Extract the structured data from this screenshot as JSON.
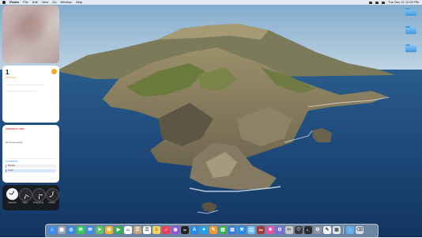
{
  "menubar": {
    "app_name": "Finder",
    "menus": [
      "File",
      "Edit",
      "View",
      "Go",
      "Window",
      "Help"
    ],
    "clock": "Tue Dec 21 12:00 PM"
  },
  "widgets": {
    "reminders": {
      "count": "1",
      "title": "Reminders"
    },
    "calendar": {
      "month": "THURSDAY 2021",
      "note": "No more events",
      "subheading": "TOMORROW",
      "events": [
        "Meeting",
        "Lunch"
      ]
    },
    "clocks": [
      {
        "city": "Cupertino",
        "style": "light"
      },
      {
        "city": "Tokyo",
        "style": "dark"
      },
      {
        "city": "Hong Kong",
        "style": "dark"
      },
      {
        "city": "London",
        "style": "dark"
      }
    ]
  },
  "dock": {
    "apps": [
      {
        "name": "Finder",
        "icon": "finder-icon",
        "color": "#3b8ff0",
        "glyph": "☺"
      },
      {
        "name": "Launchpad",
        "icon": "launchpad-icon",
        "color": "#9aa4b4",
        "glyph": "▦"
      },
      {
        "name": "Safari",
        "icon": "safari-icon",
        "color": "#2e8ae6",
        "glyph": "◎"
      },
      {
        "name": "Messages",
        "icon": "messages-icon",
        "color": "#34c759",
        "glyph": "✉"
      },
      {
        "name": "Mail",
        "icon": "mail-icon",
        "color": "#3a8ee6",
        "glyph": "✉"
      },
      {
        "name": "Maps",
        "icon": "maps-icon",
        "color": "#5ac26a",
        "glyph": "➤"
      },
      {
        "name": "Photos",
        "icon": "photos-icon",
        "color": "#f2b233",
        "glyph": "✿"
      },
      {
        "name": "FaceTime",
        "icon": "facetime-icon",
        "color": "#2fb24f",
        "glyph": "▶"
      },
      {
        "name": "Calendar",
        "icon": "calendar-icon",
        "color": "#ffffff",
        "glyph": "21"
      },
      {
        "name": "Contacts",
        "icon": "contacts-icon",
        "color": "#c9a57a",
        "glyph": "☰"
      },
      {
        "name": "Reminders",
        "icon": "reminders-icon",
        "color": "#ffffff",
        "glyph": "☰"
      },
      {
        "name": "Notes",
        "icon": "notes-icon",
        "color": "#f6d55a",
        "glyph": "≡"
      },
      {
        "name": "Music",
        "icon": "music-icon",
        "color": "#f53b57",
        "glyph": "♫"
      },
      {
        "name": "Podcasts",
        "icon": "podcasts-icon",
        "color": "#9b4de0",
        "glyph": "◉"
      },
      {
        "name": "TV",
        "icon": "tv-icon",
        "color": "#222222",
        "glyph": "tv"
      },
      {
        "name": "App Store",
        "icon": "app-store-icon",
        "color": "#1f8cf0",
        "glyph": "A"
      },
      {
        "name": "Twitter",
        "icon": "twitter-icon",
        "color": "#1da1f2",
        "glyph": "✦"
      },
      {
        "name": "Pages",
        "icon": "pages-icon",
        "color": "#f39a2b",
        "glyph": "✎"
      },
      {
        "name": "Numbers",
        "icon": "numbers-icon",
        "color": "#33b34a",
        "glyph": "▥"
      },
      {
        "name": "Keynote",
        "icon": "keynote-icon",
        "color": "#2f7de1",
        "glyph": "▤"
      },
      {
        "name": "Xcode",
        "icon": "xcode-icon",
        "color": "#1c8fe8",
        "glyph": "⚒"
      },
      {
        "name": "Screenshot",
        "icon": "screenshot-icon",
        "color": "#6cc0f5",
        "glyph": "◫"
      },
      {
        "name": "Dictionary",
        "icon": "dictionary-icon",
        "color": "#a23a3a",
        "glyph": "Aa"
      },
      {
        "name": "Color Picker",
        "icon": "color-picker-icon",
        "color": "#e94fb0",
        "glyph": "✚"
      },
      {
        "name": "Automator",
        "icon": "automator-icon",
        "color": "#7a6bd8",
        "glyph": "⚙"
      },
      {
        "name": "Script Editor",
        "icon": "script-editor-icon",
        "color": "#c8c8c8",
        "glyph": "✂"
      },
      {
        "name": "Activity Monitor",
        "icon": "activity-monitor-icon",
        "color": "#3a3a3a",
        "glyph": "♡"
      },
      {
        "name": "Terminal",
        "icon": "terminal-icon",
        "color": "#2b2b2b",
        "glyph": ">_"
      },
      {
        "name": "System Preferences",
        "icon": "system-preferences-icon",
        "color": "#8d949c",
        "glyph": "⚙"
      },
      {
        "name": "TextEdit",
        "icon": "textedit-icon",
        "color": "#f3f3f3",
        "glyph": "✎"
      },
      {
        "name": "Preview",
        "icon": "preview-icon",
        "color": "#dfe6ee",
        "glyph": "▣"
      }
    ],
    "trailing": [
      {
        "name": "Downloads",
        "icon": "downloads-folder-icon",
        "color": "#5fb0ee",
        "glyph": "↓"
      },
      {
        "name": "Trash",
        "icon": "trash-icon",
        "color": "#d5dde6",
        "glyph": "⌫"
      }
    ]
  },
  "colors": {
    "ocean": "#1a4a78",
    "island": "#8a7a5a",
    "sky": "#8fb8d8"
  }
}
